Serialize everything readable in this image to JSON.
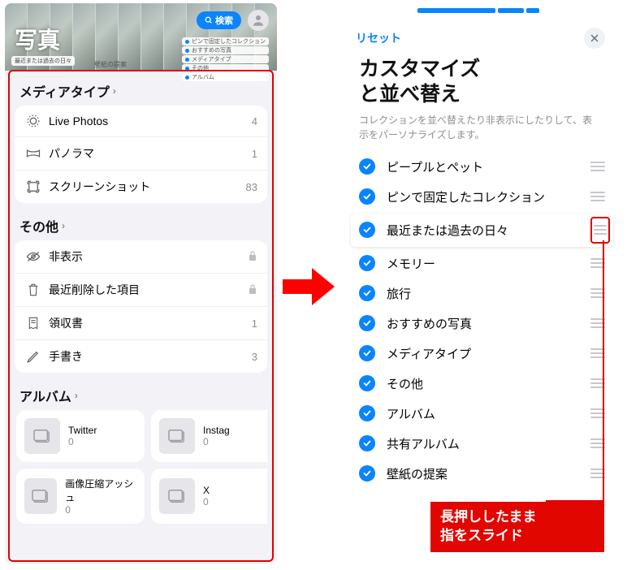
{
  "left": {
    "app_title": "写真",
    "search_label": "検索",
    "header_strip_left": "最近または過去の日々",
    "header_strip_center": "壁紙の提案",
    "top_pills": [
      "ピンで固定したコレクション",
      "おすすめの写真",
      "メディアタイプ",
      "その他",
      "アルバム"
    ],
    "sections": {
      "media_type": {
        "title": "メディアタイプ",
        "items": [
          {
            "icon": "live-photos-icon",
            "label": "Live Photos",
            "count": "4"
          },
          {
            "icon": "panorama-icon",
            "label": "パノラマ",
            "count": "1"
          },
          {
            "icon": "screenshot-icon",
            "label": "スクリーンショット",
            "count": "83"
          }
        ]
      },
      "other": {
        "title": "その他",
        "items": [
          {
            "icon": "hidden-icon",
            "label": "非表示",
            "locked": true
          },
          {
            "icon": "trash-icon",
            "label": "最近削除した項目",
            "locked": true
          },
          {
            "icon": "receipt-icon",
            "label": "領収書",
            "count": "1"
          },
          {
            "icon": "handwriting-icon",
            "label": "手書き",
            "count": "3"
          }
        ]
      },
      "albums": {
        "title": "アルバム",
        "cards": [
          {
            "name": "Twitter",
            "count": "0"
          },
          {
            "name": "Instag",
            "count": "0"
          },
          {
            "name": "画像圧縮アッシュ",
            "count": "0"
          },
          {
            "name": "X",
            "count": "0"
          }
        ]
      }
    }
  },
  "right": {
    "reset_label": "リセット",
    "title_line1": "カスタマイズ",
    "title_line2": "と並べ替え",
    "description": "コレクションを並べ替えたり非表示にしたりして、表示をパーソナライズします。",
    "rows": [
      {
        "label": "ピープルとペット"
      },
      {
        "label": "ピンで固定したコレクション"
      },
      {
        "label": "最近または過去の日々",
        "highlighted": true
      },
      {
        "label": "メモリー"
      },
      {
        "label": "旅行"
      },
      {
        "label": "おすすめの写真"
      },
      {
        "label": "メディアタイプ"
      },
      {
        "label": "その他"
      },
      {
        "label": "アルバム"
      },
      {
        "label": "共有アルバム"
      },
      {
        "label": "壁紙の提案"
      }
    ]
  },
  "callout_line1": "長押ししたまま",
  "callout_line2": "指をスライド"
}
